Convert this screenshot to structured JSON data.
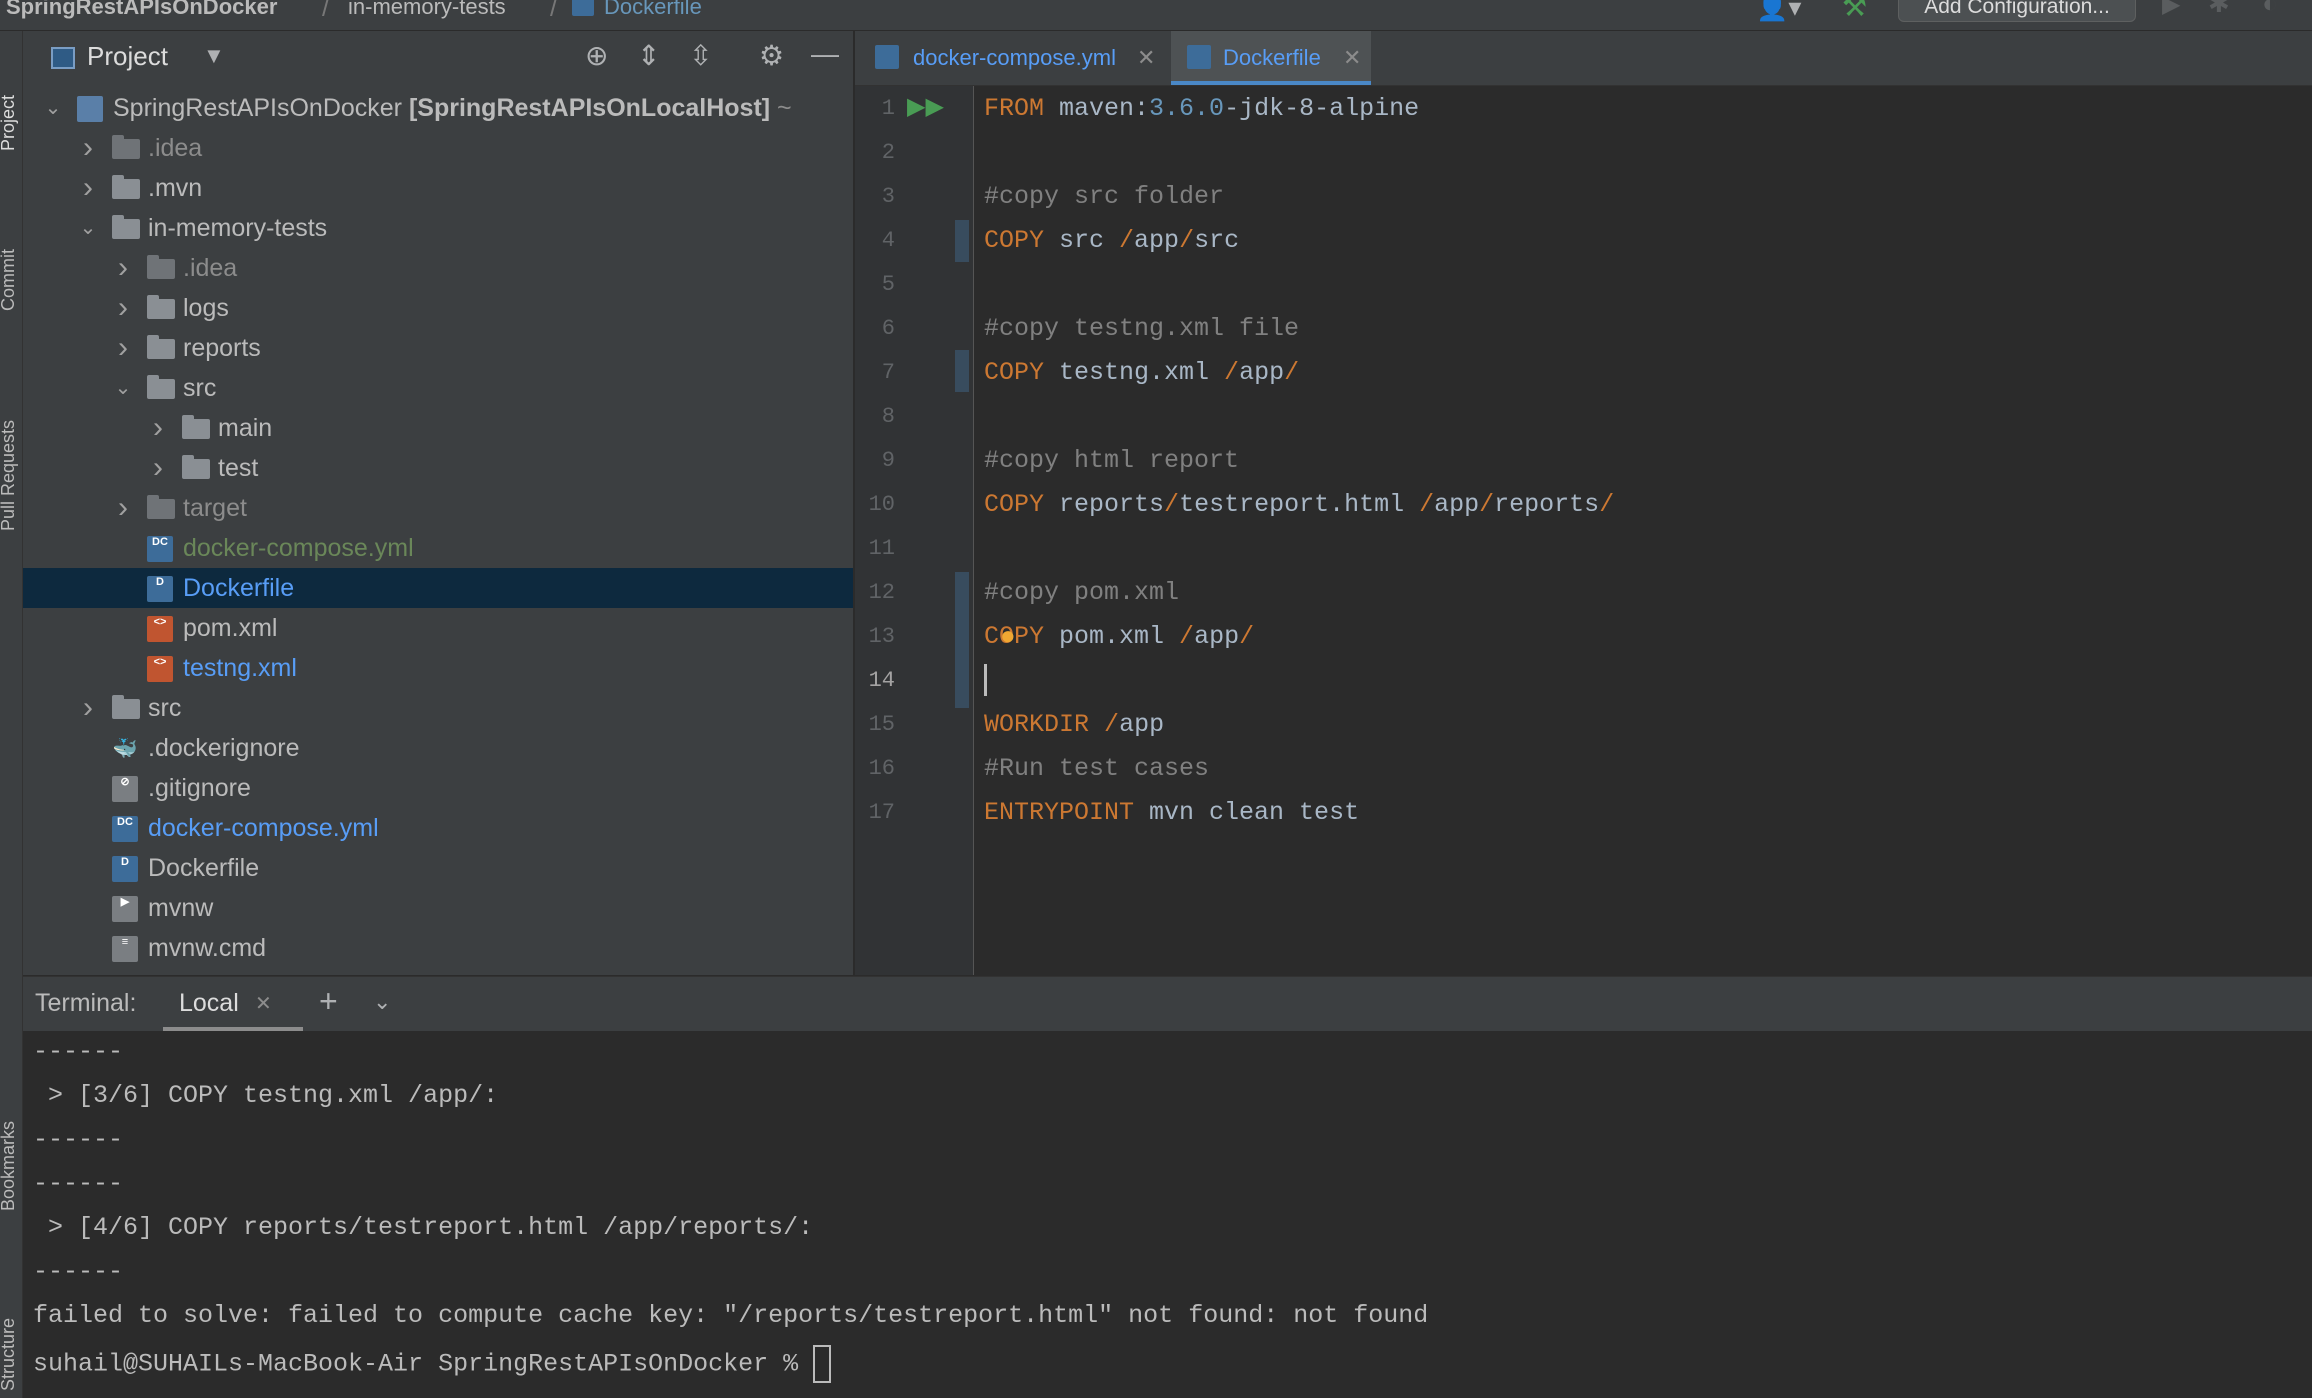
{
  "breadcrumb": {
    "project": "SpringRestAPIsOnDocker",
    "folder": "in-memory-tests",
    "file": "Dockerfile"
  },
  "toolbar": {
    "add_config_label": "Add Configuration..."
  },
  "left_strip": {
    "project": "Project",
    "commit": "Commit",
    "pull_requests": "Pull Requests",
    "bookmarks": "Bookmarks",
    "structure": "Structure"
  },
  "project_panel": {
    "title": "Project",
    "tree": [
      {
        "label": "SpringRestAPIsOnDocker",
        "extra": "[SpringRestAPIsOnLocalHost]",
        "suffix": "~",
        "depth": 0,
        "expanded": true,
        "type": "module"
      },
      {
        "label": ".idea",
        "depth": 1,
        "expanded": false,
        "type": "folder",
        "style": "dim"
      },
      {
        "label": ".mvn",
        "depth": 1,
        "expanded": false,
        "type": "folder",
        "style": "def"
      },
      {
        "label": "in-memory-tests",
        "depth": 1,
        "expanded": true,
        "type": "folder",
        "style": "def"
      },
      {
        "label": ".idea",
        "depth": 2,
        "expanded": false,
        "type": "folder",
        "style": "dim"
      },
      {
        "label": "logs",
        "depth": 2,
        "expanded": false,
        "type": "folder",
        "style": "def"
      },
      {
        "label": "reports",
        "depth": 2,
        "expanded": false,
        "type": "folder",
        "style": "def"
      },
      {
        "label": "src",
        "depth": 2,
        "expanded": true,
        "type": "folder",
        "style": "def"
      },
      {
        "label": "main",
        "depth": 3,
        "expanded": false,
        "type": "folder",
        "style": "def"
      },
      {
        "label": "test",
        "depth": 3,
        "expanded": false,
        "type": "folder",
        "style": "def"
      },
      {
        "label": "target",
        "depth": 2,
        "expanded": false,
        "type": "folder",
        "style": "dim"
      },
      {
        "label": "docker-compose.yml",
        "depth": 2,
        "type": "compose",
        "style": "green"
      },
      {
        "label": "Dockerfile",
        "depth": 2,
        "type": "docker",
        "style": "blue",
        "selected": true
      },
      {
        "label": "pom.xml",
        "depth": 2,
        "type": "xml",
        "style": "def"
      },
      {
        "label": "testng.xml",
        "depth": 2,
        "type": "xml",
        "style": "blue"
      },
      {
        "label": "src",
        "depth": 1,
        "expanded": false,
        "type": "folder",
        "style": "def"
      },
      {
        "label": ".dockerignore",
        "depth": 1,
        "type": "whale",
        "style": "def"
      },
      {
        "label": ".gitignore",
        "depth": 1,
        "type": "ignore",
        "style": "def"
      },
      {
        "label": "docker-compose.yml",
        "depth": 1,
        "type": "compose",
        "style": "blue"
      },
      {
        "label": "Dockerfile",
        "depth": 1,
        "type": "docker",
        "style": "def"
      },
      {
        "label": "mvnw",
        "depth": 1,
        "type": "exec",
        "style": "def"
      },
      {
        "label": "mvnw.cmd",
        "depth": 1,
        "type": "text",
        "style": "def"
      }
    ]
  },
  "editor": {
    "tabs": [
      {
        "label": "docker-compose.yml",
        "active": false
      },
      {
        "label": "Dockerfile",
        "active": true
      }
    ],
    "current_line": 14,
    "lines": [
      [
        [
          "k",
          "FROM"
        ],
        [
          "t",
          " maven:"
        ],
        [
          "n",
          "3.6.0"
        ],
        [
          "t",
          "-jdk-8-alpine"
        ]
      ],
      [],
      [
        [
          "cm",
          "#copy src folder"
        ]
      ],
      [
        [
          "k",
          "COPY"
        ],
        [
          "t",
          " src "
        ],
        [
          "sl",
          "/"
        ],
        [
          "t",
          "app"
        ],
        [
          "sl",
          "/"
        ],
        [
          "t",
          "src"
        ]
      ],
      [],
      [
        [
          "cm",
          "#copy testng.xml file"
        ]
      ],
      [
        [
          "k",
          "COPY"
        ],
        [
          "t",
          " testng.xml "
        ],
        [
          "sl",
          "/"
        ],
        [
          "t",
          "app"
        ],
        [
          "sl",
          "/"
        ]
      ],
      [],
      [
        [
          "cm",
          "#copy html report"
        ]
      ],
      [
        [
          "k",
          "COPY"
        ],
        [
          "t",
          " reports"
        ],
        [
          "sl",
          "/"
        ],
        [
          "t",
          "testreport.html "
        ],
        [
          "sl",
          "/"
        ],
        [
          "t",
          "app"
        ],
        [
          "sl",
          "/"
        ],
        [
          "t",
          "reports"
        ],
        [
          "sl",
          "/"
        ]
      ],
      [],
      [
        [
          "cm",
          "#copy pom.xml"
        ]
      ],
      [
        [
          "k",
          "COPY"
        ],
        [
          "t",
          " pom.xml "
        ],
        [
          "sl",
          "/"
        ],
        [
          "t",
          "app"
        ],
        [
          "sl",
          "/"
        ]
      ],
      [],
      [
        [
          "k",
          "WORKDIR"
        ],
        [
          "t",
          " "
        ],
        [
          "sl",
          "/"
        ],
        [
          "t",
          "app"
        ]
      ],
      [
        [
          "cm",
          "#Run test cases"
        ]
      ],
      [
        [
          "k",
          "ENTRYPOINT"
        ],
        [
          "t",
          " mvn clean test"
        ]
      ]
    ]
  },
  "terminal": {
    "label": "Terminal:",
    "tab": "Local",
    "lines": [
      "------",
      " > [3/6] COPY testng.xml /app/:",
      "------",
      "------",
      " > [4/6] COPY reports/testreport.html /app/reports/:",
      "------",
      "failed to solve: failed to compute cache key: \"/reports/testreport.html\" not found: not found",
      "suhail@SUHAILs-MacBook-Air SpringRestAPIsOnDocker % "
    ]
  }
}
